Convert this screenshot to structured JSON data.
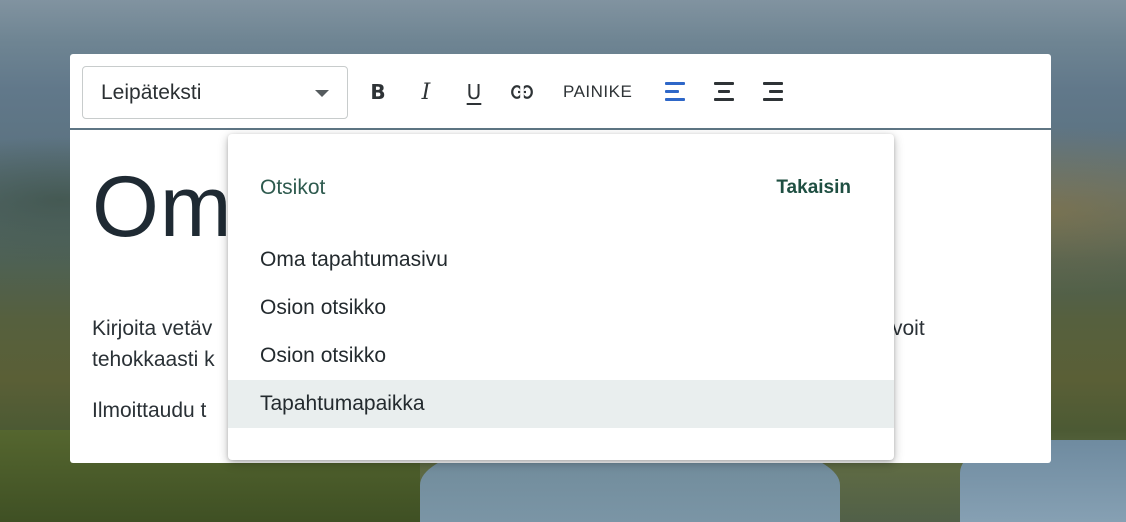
{
  "toolbar": {
    "style_select": {
      "value": "Leipäteksti"
    },
    "bold": "B",
    "italic": "I",
    "underline": "U",
    "button_label": "PAINIKE",
    "link_icon": "link-icon",
    "active_align": "left",
    "accent_color": "#2e67c8"
  },
  "content": {
    "heading": "Om",
    "para1_line1": "Kirjoita vetäv",
    "para1_line1_end": "voit",
    "para1_line2": "tehokkaasti k",
    "para2": "Ilmoittaudu t"
  },
  "dropdown": {
    "header": "Otsikot",
    "back_label": "Takaisin",
    "items": [
      {
        "label": "Oma tapahtumasivu"
      },
      {
        "label": "Osion otsikko"
      },
      {
        "label": "Osion otsikko"
      },
      {
        "label": "Tapahtumapaikka"
      }
    ],
    "highlight_color": "#e9eeee",
    "header_color": "#2e5a4e"
  }
}
